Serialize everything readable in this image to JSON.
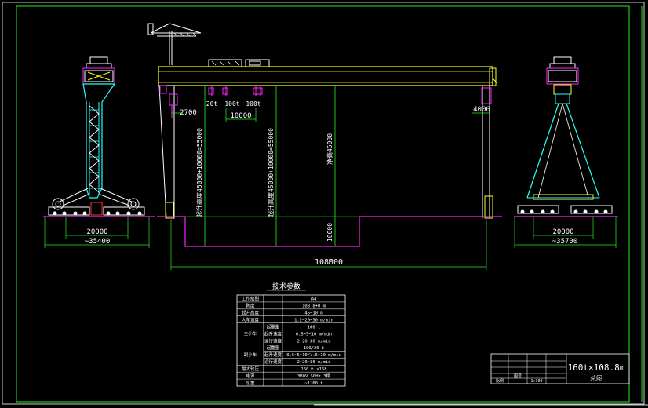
{
  "colors": {
    "background": "#000000",
    "frame": "#22ee22",
    "structure": "#ffffff",
    "girder": "#ffff22",
    "dimension": "#22ee22",
    "hoist": "#ff22ff",
    "ground": "#ff22ff",
    "cyan": "#22ffff",
    "red": "#ff3333"
  },
  "left_view": {
    "span_dim": "20000",
    "base_dim": "~35400"
  },
  "right_view": {
    "span_dim": "20000",
    "base_dim": "~35700"
  },
  "front_view": {
    "hook_labels": [
      "20t",
      "100t",
      "100t"
    ],
    "hook_spacing": "10000",
    "left_offset": "2700",
    "right_offset": "4000",
    "lift_height_1": "起升高度45000+10000=55000",
    "lift_height_2": "起升高度45000+10000=55000",
    "clear_height": "净高45000",
    "pit_depth": "10000",
    "span": "108800"
  },
  "spec_table": {
    "title": "技术参数",
    "rows": [
      {
        "group": "",
        "label": "工作级别",
        "value": "A4"
      },
      {
        "group": "",
        "label": "跨度",
        "value": "108.8+0  m"
      },
      {
        "group": "",
        "label": "起升高度",
        "value": "45+10  m"
      },
      {
        "group": "",
        "label": "大车速度",
        "value": "1.2~20~30  m/min"
      },
      {
        "group": "主小车",
        "label": "起重量",
        "value": "160  t"
      },
      {
        "group": "主小车",
        "label": "起升速度",
        "value": "0.5~5~10  m/min"
      },
      {
        "group": "主小车",
        "label": "运行速度",
        "value": "2~20~30  m/min"
      },
      {
        "group": "副小车",
        "label": "起重量",
        "value": "100/20  t"
      },
      {
        "group": "副小车",
        "label": "起升速度",
        "value": "0.5~5~10/1.5~10  m/min"
      },
      {
        "group": "副小车",
        "label": "运行速度",
        "value": "2~20~30  m/min"
      },
      {
        "group": "",
        "label": "最大轮压",
        "value": "160  t  ×168"
      },
      {
        "group": "",
        "label": "电源",
        "value": "380V 50Hz  3相"
      },
      {
        "group": "",
        "label": "总重",
        "value": "~1160  t"
      }
    ]
  },
  "title_block": {
    "title": "160t×108.8m",
    "subtitle": "总图",
    "row_1": "比例",
    "row_2": "图号",
    "scale": "1:300"
  }
}
